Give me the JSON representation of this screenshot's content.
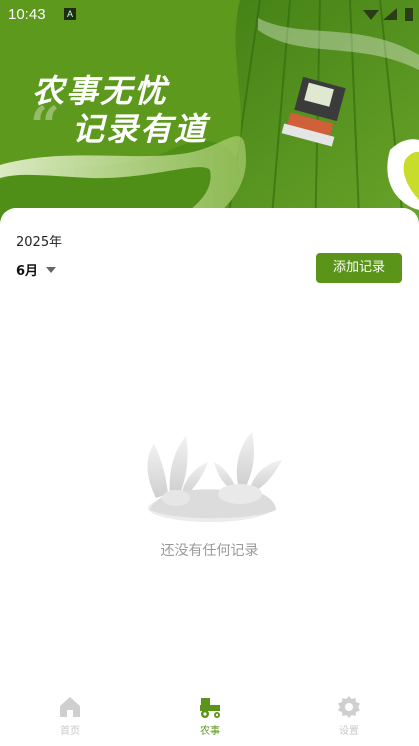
{
  "status_bar": {
    "time": "10:43",
    "notification_badge": "A"
  },
  "hero": {
    "title_line1": "农事无忧",
    "title_line2": "记录有道",
    "quote_glyph": "“"
  },
  "records": {
    "year": "2025年",
    "month": "6月",
    "add_button": "添加记录",
    "empty_text": "还没有任何记录"
  },
  "nav": {
    "items": [
      {
        "label": "首页",
        "icon": "home-icon",
        "active": false
      },
      {
        "label": "农事",
        "icon": "tractor-icon",
        "active": true
      },
      {
        "label": "设置",
        "icon": "gear-icon",
        "active": false
      }
    ]
  },
  "colors": {
    "accent": "#5a9418",
    "inactive": "#c8c8c8",
    "hero_green": "#4f8a1c"
  }
}
